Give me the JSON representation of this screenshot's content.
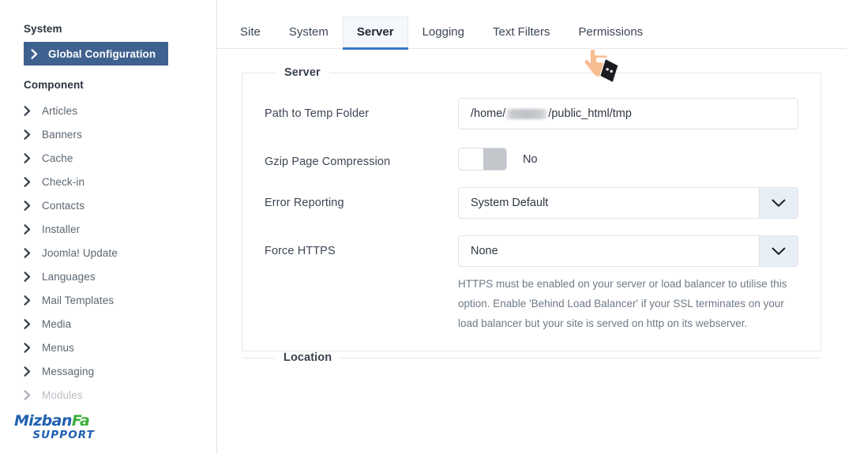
{
  "sidebar": {
    "groups": [
      {
        "title": "System",
        "items": [
          {
            "label": "Global Configuration",
            "active": true,
            "faded": false
          }
        ]
      },
      {
        "title": "Component",
        "items": [
          {
            "label": "Articles",
            "active": false,
            "faded": false
          },
          {
            "label": "Banners",
            "active": false,
            "faded": false
          },
          {
            "label": "Cache",
            "active": false,
            "faded": false
          },
          {
            "label": "Check-in",
            "active": false,
            "faded": false
          },
          {
            "label": "Contacts",
            "active": false,
            "faded": false
          },
          {
            "label": "Installer",
            "active": false,
            "faded": false
          },
          {
            "label": "Joomla! Update",
            "active": false,
            "faded": false
          },
          {
            "label": "Languages",
            "active": false,
            "faded": false
          },
          {
            "label": "Mail Templates",
            "active": false,
            "faded": false
          },
          {
            "label": "Media",
            "active": false,
            "faded": false
          },
          {
            "label": "Menus",
            "active": false,
            "faded": false
          },
          {
            "label": "Messaging",
            "active": false,
            "faded": false
          },
          {
            "label": "Modules",
            "active": false,
            "faded": true
          }
        ]
      }
    ],
    "logo": {
      "brand_part1": "Mizban",
      "brand_part2": "Fa",
      "tagline": "SUPPORT",
      "color_blue": "#1f5fb0",
      "color_green": "#3dae3a"
    }
  },
  "tabs": [
    {
      "label": "Site",
      "active": false
    },
    {
      "label": "System",
      "active": false
    },
    {
      "label": "Server",
      "active": true
    },
    {
      "label": "Logging",
      "active": false
    },
    {
      "label": "Text Filters",
      "active": false
    },
    {
      "label": "Permissions",
      "active": false
    }
  ],
  "accent_color": "#3b76c4",
  "fieldsets": {
    "server": {
      "legend": "Server",
      "rows": {
        "temp_folder": {
          "label": "Path to Temp Folder",
          "value_prefix": "/home/",
          "value_suffix": "/public_html/tmp",
          "redacted": true
        },
        "gzip": {
          "label": "Gzip Page Compression",
          "state_label": "No",
          "enabled": false
        },
        "error_reporting": {
          "label": "Error Reporting",
          "value": "System Default"
        },
        "force_https": {
          "label": "Force HTTPS",
          "value": "None",
          "help": "HTTPS must be enabled on your server or load balancer to utilise this option. Enable 'Behind Load Balancer' if your SSL terminates on your load balancer but your site is served on http on its webserver."
        }
      }
    },
    "location": {
      "legend": "Location"
    }
  },
  "cursor": {
    "type": "pointing-hand",
    "skin_color": "#f7bd92",
    "sleeve_color": "#1c1c20"
  }
}
